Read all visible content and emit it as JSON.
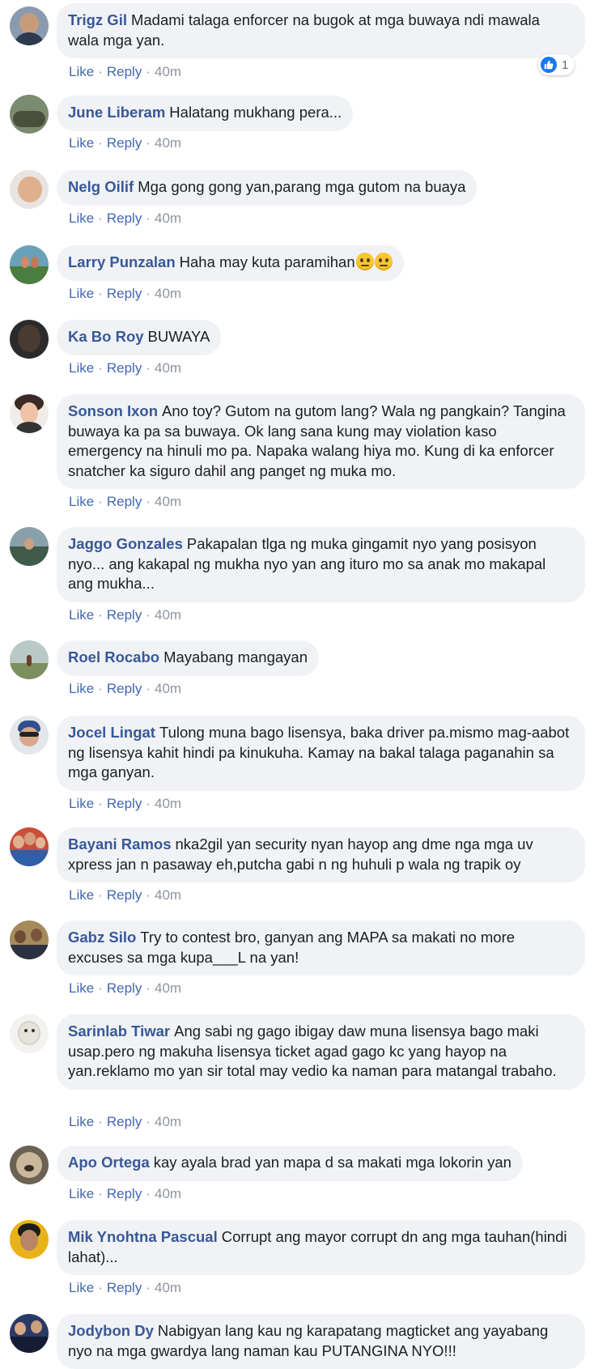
{
  "actions": {
    "like": "Like",
    "reply": "Reply",
    "separator": "·"
  },
  "comments": [
    {
      "author": "Trigz Gil",
      "text": "Madami talaga enforcer na bugok at mga buwaya ndi mawala wala mga yan.",
      "time": "40m",
      "reaction_count": "1"
    },
    {
      "author": "June Liberam",
      "text": "Halatang mukhang pera...",
      "time": "40m"
    },
    {
      "author": "Nelg Oilif",
      "text": "Mga gong gong yan,parang mga gutom na buaya",
      "time": "40m"
    },
    {
      "author": "Larry Punzalan",
      "text": "Haha may kuta paramihan",
      "emoji": "face-with-rolling-eyes",
      "time": "40m"
    },
    {
      "author": "Ka Bo Roy",
      "text": "BUWAYA",
      "time": "40m"
    },
    {
      "author": "Sonson Ixon",
      "text": "Ano toy? Gutom na gutom lang? Wala ng pangkain? Tangina buwaya ka pa sa buwaya. Ok lang sana kung may violation kaso emergency na hinuli mo pa. Napaka walang hiya mo. Kung di ka enforcer snatcher ka siguro dahil ang panget ng muka mo.",
      "time": "40m"
    },
    {
      "author": "Jaggo Gonzales",
      "text": "Pakapalan tlga ng muka gingamit nyo yang posisyon nyo... ang kakapal ng mukha nyo yan ang ituro mo sa anak mo makapal ang mukha...",
      "time": "40m"
    },
    {
      "author": "Roel Rocabo",
      "text": "Mayabang mangayan",
      "time": "40m"
    },
    {
      "author": "Jocel Lingat",
      "text": "Tulong muna bago lisensya, baka driver pa.mismo mag-aabot ng lisensya kahit hindi pa kinukuha. Kamay na bakal talaga paganahin sa mga ganyan.",
      "time": "40m"
    },
    {
      "author": "Bayani Ramos",
      "text": "nka2gil yan security nyan hayop ang dme nga mga uv xpress jan n pasaway eh,putcha gabi n ng huhuli p wala ng trapik oy",
      "time": "40m"
    },
    {
      "author": "Gabz Silo",
      "text": "Try to contest bro, ganyan ang MAPA sa makati no more excuses sa mga kupa___L na yan!",
      "time": "40m"
    },
    {
      "author": "Sarinlab Tiwar",
      "text": "Ang sabi ng gago ibigay daw muna lisensya bago maki usap.pero ng makuha lisensya ticket agad gago kc yang hayop na yan.reklamo mo yan sir total may vedio ka naman para matangal trabaho.",
      "time": "40m"
    },
    {
      "author": "Apo Ortega",
      "text": "kay ayala brad yan mapa d sa makati mga lokorin yan",
      "time": "40m"
    },
    {
      "author": "Mik Ynohtna Pascual",
      "text": "Corrupt ang mayor corrupt dn ang mga tauhan(hindi lahat)...",
      "time": "40m"
    },
    {
      "author": "Jodybon Dy",
      "text": "Nabigyan lang kau ng karapatang magticket ang yayabang nyo na mga gwardya lang naman kau PUTANGINA NYO!!!"
    }
  ]
}
